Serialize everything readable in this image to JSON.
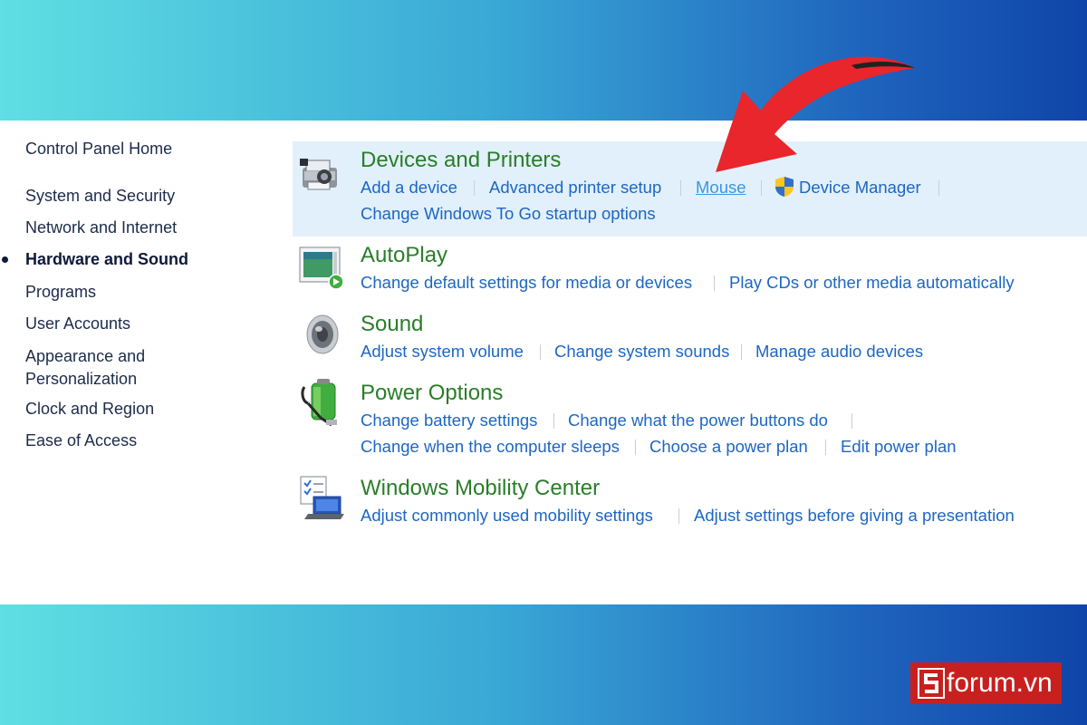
{
  "sidebar": {
    "items": [
      {
        "label": "Control Panel Home"
      },
      {
        "label": "System and Security"
      },
      {
        "label": "Network and Internet"
      },
      {
        "label": "Hardware and Sound"
      },
      {
        "label": "Programs"
      },
      {
        "label": "User Accounts"
      },
      {
        "label": "Appearance and"
      },
      {
        "label": "Personalization"
      },
      {
        "label": "Clock and Region"
      },
      {
        "label": "Ease of Access"
      }
    ],
    "active": "Hardware and Sound"
  },
  "categories": {
    "devices": {
      "title": "Devices and Printers",
      "links": [
        "Add a device",
        "Advanced printer setup",
        "Mouse",
        "Device Manager",
        "Change Windows To Go startup options"
      ],
      "icon": "devices-printers-icon",
      "hovered": "Mouse"
    },
    "autoplay": {
      "title": "AutoPlay",
      "links": [
        "Change default settings for media or devices",
        "Play CDs or other media automatically"
      ],
      "icon": "autoplay-icon"
    },
    "sound": {
      "title": "Sound",
      "links": [
        "Adjust system volume",
        "Change system sounds",
        "Manage audio devices"
      ],
      "icon": "speaker-icon"
    },
    "power": {
      "title": "Power Options",
      "links": [
        "Change battery settings",
        "Change what the power buttons do",
        "Change when the computer sleeps",
        "Choose a power plan",
        "Edit power plan"
      ],
      "icon": "battery-icon"
    },
    "mobility": {
      "title": "Windows Mobility Center",
      "links": [
        "Adjust commonly used mobility settings",
        "Adjust settings before giving a presentation"
      ],
      "icon": "laptop-checklist-icon"
    }
  },
  "watermark": {
    "text": "forum.vn",
    "logo_letter": "S"
  },
  "colors": {
    "link": "#1d66c2",
    "link_hover": "#3a97e0",
    "category_title": "#2a7d2a",
    "highlight": "#e2f0fb",
    "arrow": "#e8262b",
    "logo_bg": "#c8201f"
  }
}
